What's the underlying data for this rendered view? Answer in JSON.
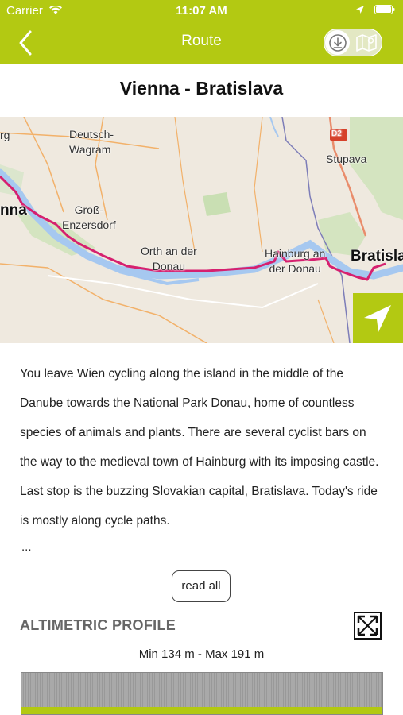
{
  "status_bar": {
    "carrier": "Carrier",
    "time": "11:07 AM"
  },
  "nav": {
    "title": "Route"
  },
  "route": {
    "title": "Vienna - Bratislava"
  },
  "map": {
    "labels": {
      "deutsch_wagram": "Deutsch-\nWagram",
      "gross_enzersdorf": "Groß-\nEnzersdorf",
      "orth": "Orth an der\nDonau",
      "hainburg": "Hainburg an\nder Donau",
      "stupava": "Stupava",
      "bratislava": "Bratisla",
      "vienna": "nna",
      "left_top": "rg",
      "road": "D2"
    }
  },
  "description": {
    "text": "You leave Wien cycling along the island in the middle of the Danube towards the National Park Donau, home of countless species of animals and plants. There are several cyclist bars on the way to the medieval town of Hainburg with its imposing castle. Last stop is the buzzing Slovakian capital, Bratislava. Today's ride is mostly along cycle paths.",
    "ellipsis": "..."
  },
  "read_all_label": "read all",
  "altimetric": {
    "title": "ALTIMETRIC PROFILE",
    "min_max": "Min 134 m - Max 191 m"
  },
  "colors": {
    "accent": "#b3c912",
    "route": "#d6206f",
    "river": "#a6c8f0"
  }
}
